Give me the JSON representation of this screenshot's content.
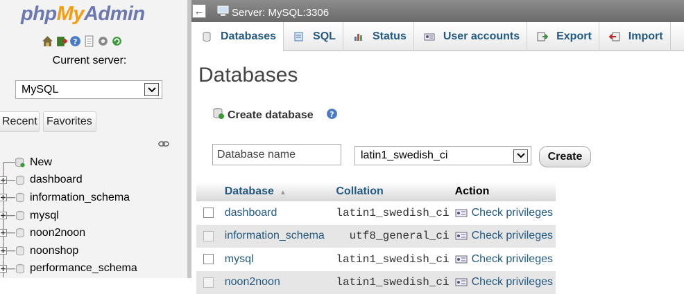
{
  "nav": {
    "logo_php": "php",
    "logo_my": "My",
    "logo_admin": "Admin",
    "icons": [
      "home-icon",
      "exit-icon",
      "help-icon",
      "docs-icon",
      "settings-icon",
      "reload-icon"
    ],
    "current_server_label": "Current server:",
    "server_select_value": "MySQL",
    "recent_label": "Recent",
    "favorites_label": "Favorites",
    "tree": [
      {
        "label": "New",
        "type": "new"
      },
      {
        "label": "dashboard",
        "type": "db"
      },
      {
        "label": "information_schema",
        "type": "db"
      },
      {
        "label": "mysql",
        "type": "db"
      },
      {
        "label": "noon2noon",
        "type": "db"
      },
      {
        "label": "noonshop",
        "type": "db"
      },
      {
        "label": "performance_schema",
        "type": "db"
      }
    ]
  },
  "serverbar": {
    "crumb": "Server: MySQL:3306"
  },
  "tabs": [
    {
      "label": "Databases",
      "icon": "database-icon",
      "active": true
    },
    {
      "label": "SQL",
      "icon": "sql-icon",
      "active": false
    },
    {
      "label": "Status",
      "icon": "status-icon",
      "active": false
    },
    {
      "label": "User accounts",
      "icon": "users-icon",
      "active": false
    },
    {
      "label": "Export",
      "icon": "export-icon",
      "active": false
    },
    {
      "label": "Import",
      "icon": "import-icon",
      "active": false
    }
  ],
  "main": {
    "title": "Databases",
    "create_db_label": "Create database",
    "dbname_placeholder": "Database name",
    "collation_value": "latin1_swedish_ci",
    "create_button": "Create",
    "table": {
      "headers": {
        "database": "Database",
        "collation": "Collation",
        "action": "Action"
      },
      "rows": [
        {
          "name": "dashboard",
          "collation": "latin1_swedish_ci",
          "action": "Check privileges"
        },
        {
          "name": "information_schema",
          "collation": "utf8_general_ci",
          "action": "Check privileges"
        },
        {
          "name": "mysql",
          "collation": "latin1_swedish_ci",
          "action": "Check privileges"
        },
        {
          "name": "noon2noon",
          "collation": "latin1_swedish_ci",
          "action": "Check privileges"
        }
      ]
    }
  },
  "colors": {
    "link": "#235a81",
    "logo_blue": "#6c78af",
    "logo_orange": "#f89c0e",
    "serverbar": "#7a7a7a"
  }
}
